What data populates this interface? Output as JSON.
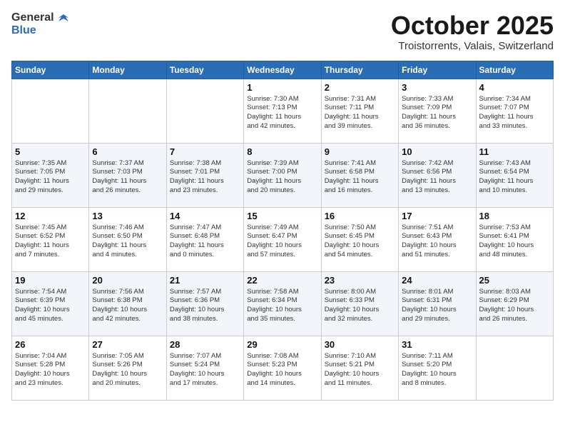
{
  "header": {
    "logo_general": "General",
    "logo_blue": "Blue",
    "title": "October 2025",
    "location": "Troistorrents, Valais, Switzerland"
  },
  "days_of_week": [
    "Sunday",
    "Monday",
    "Tuesday",
    "Wednesday",
    "Thursday",
    "Friday",
    "Saturday"
  ],
  "weeks": [
    [
      {
        "day": "",
        "info": ""
      },
      {
        "day": "",
        "info": ""
      },
      {
        "day": "",
        "info": ""
      },
      {
        "day": "1",
        "info": "Sunrise: 7:30 AM\nSunset: 7:13 PM\nDaylight: 11 hours\nand 42 minutes."
      },
      {
        "day": "2",
        "info": "Sunrise: 7:31 AM\nSunset: 7:11 PM\nDaylight: 11 hours\nand 39 minutes."
      },
      {
        "day": "3",
        "info": "Sunrise: 7:33 AM\nSunset: 7:09 PM\nDaylight: 11 hours\nand 36 minutes."
      },
      {
        "day": "4",
        "info": "Sunrise: 7:34 AM\nSunset: 7:07 PM\nDaylight: 11 hours\nand 33 minutes."
      }
    ],
    [
      {
        "day": "5",
        "info": "Sunrise: 7:35 AM\nSunset: 7:05 PM\nDaylight: 11 hours\nand 29 minutes."
      },
      {
        "day": "6",
        "info": "Sunrise: 7:37 AM\nSunset: 7:03 PM\nDaylight: 11 hours\nand 26 minutes."
      },
      {
        "day": "7",
        "info": "Sunrise: 7:38 AM\nSunset: 7:01 PM\nDaylight: 11 hours\nand 23 minutes."
      },
      {
        "day": "8",
        "info": "Sunrise: 7:39 AM\nSunset: 7:00 PM\nDaylight: 11 hours\nand 20 minutes."
      },
      {
        "day": "9",
        "info": "Sunrise: 7:41 AM\nSunset: 6:58 PM\nDaylight: 11 hours\nand 16 minutes."
      },
      {
        "day": "10",
        "info": "Sunrise: 7:42 AM\nSunset: 6:56 PM\nDaylight: 11 hours\nand 13 minutes."
      },
      {
        "day": "11",
        "info": "Sunrise: 7:43 AM\nSunset: 6:54 PM\nDaylight: 11 hours\nand 10 minutes."
      }
    ],
    [
      {
        "day": "12",
        "info": "Sunrise: 7:45 AM\nSunset: 6:52 PM\nDaylight: 11 hours\nand 7 minutes."
      },
      {
        "day": "13",
        "info": "Sunrise: 7:46 AM\nSunset: 6:50 PM\nDaylight: 11 hours\nand 4 minutes."
      },
      {
        "day": "14",
        "info": "Sunrise: 7:47 AM\nSunset: 6:48 PM\nDaylight: 11 hours\nand 0 minutes."
      },
      {
        "day": "15",
        "info": "Sunrise: 7:49 AM\nSunset: 6:47 PM\nDaylight: 10 hours\nand 57 minutes."
      },
      {
        "day": "16",
        "info": "Sunrise: 7:50 AM\nSunset: 6:45 PM\nDaylight: 10 hours\nand 54 minutes."
      },
      {
        "day": "17",
        "info": "Sunrise: 7:51 AM\nSunset: 6:43 PM\nDaylight: 10 hours\nand 51 minutes."
      },
      {
        "day": "18",
        "info": "Sunrise: 7:53 AM\nSunset: 6:41 PM\nDaylight: 10 hours\nand 48 minutes."
      }
    ],
    [
      {
        "day": "19",
        "info": "Sunrise: 7:54 AM\nSunset: 6:39 PM\nDaylight: 10 hours\nand 45 minutes."
      },
      {
        "day": "20",
        "info": "Sunrise: 7:56 AM\nSunset: 6:38 PM\nDaylight: 10 hours\nand 42 minutes."
      },
      {
        "day": "21",
        "info": "Sunrise: 7:57 AM\nSunset: 6:36 PM\nDaylight: 10 hours\nand 38 minutes."
      },
      {
        "day": "22",
        "info": "Sunrise: 7:58 AM\nSunset: 6:34 PM\nDaylight: 10 hours\nand 35 minutes."
      },
      {
        "day": "23",
        "info": "Sunrise: 8:00 AM\nSunset: 6:33 PM\nDaylight: 10 hours\nand 32 minutes."
      },
      {
        "day": "24",
        "info": "Sunrise: 8:01 AM\nSunset: 6:31 PM\nDaylight: 10 hours\nand 29 minutes."
      },
      {
        "day": "25",
        "info": "Sunrise: 8:03 AM\nSunset: 6:29 PM\nDaylight: 10 hours\nand 26 minutes."
      }
    ],
    [
      {
        "day": "26",
        "info": "Sunrise: 7:04 AM\nSunset: 5:28 PM\nDaylight: 10 hours\nand 23 minutes."
      },
      {
        "day": "27",
        "info": "Sunrise: 7:05 AM\nSunset: 5:26 PM\nDaylight: 10 hours\nand 20 minutes."
      },
      {
        "day": "28",
        "info": "Sunrise: 7:07 AM\nSunset: 5:24 PM\nDaylight: 10 hours\nand 17 minutes."
      },
      {
        "day": "29",
        "info": "Sunrise: 7:08 AM\nSunset: 5:23 PM\nDaylight: 10 hours\nand 14 minutes."
      },
      {
        "day": "30",
        "info": "Sunrise: 7:10 AM\nSunset: 5:21 PM\nDaylight: 10 hours\nand 11 minutes."
      },
      {
        "day": "31",
        "info": "Sunrise: 7:11 AM\nSunset: 5:20 PM\nDaylight: 10 hours\nand 8 minutes."
      },
      {
        "day": "",
        "info": ""
      }
    ]
  ]
}
